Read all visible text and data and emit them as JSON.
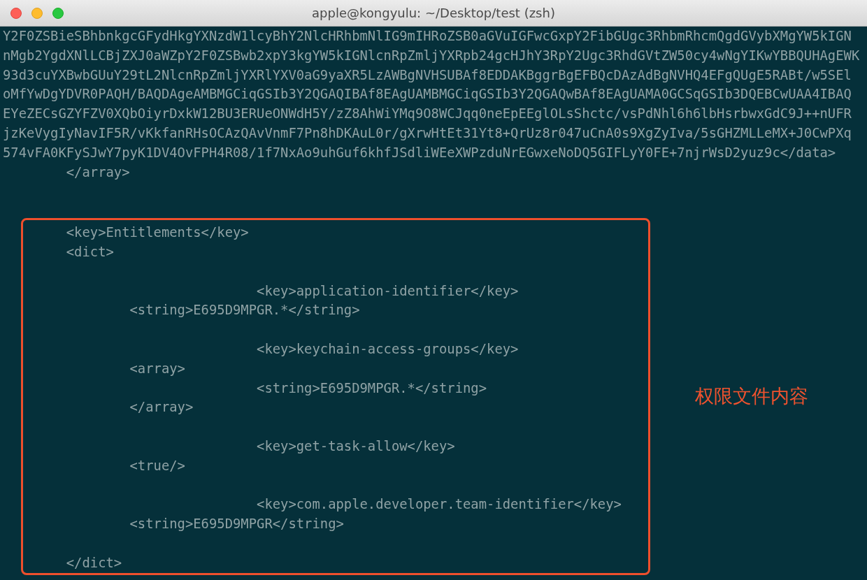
{
  "window": {
    "title": "apple@kongyulu: ~/Desktop/test (zsh)"
  },
  "lines": [
    {
      "kind": "code",
      "text": "Y2F0ZSBieSBhbnkgcGFydHkgYXNzdW1lcyBhY2NlcHRhbmNlIG9mIHRoZSB0aGVuIGFwcGxpY2FibGUgc3RhbmRhcmQgdGVybXMgYW5kIGN"
    },
    {
      "kind": "code",
      "text": "nMgb2YgdXNlLCBjZXJ0aWZpY2F0ZSBwb2xpY3kgYW5kIGNlcnRpZmljYXRpb24gcHJhY3RpY2Ugc3RhdGVtZW50cy4wNgYIKwYBBQUHAgEWK"
    },
    {
      "kind": "code",
      "text": "93d3cuYXBwbGUuY29tL2NlcnRpZmljYXRlYXV0aG9yaXR5LzAWBgNVHSUBAf8EDDAKBggrBgEFBQcDAzAdBgNVHQ4EFgQUgE5RABt/w5SEl"
    },
    {
      "kind": "code",
      "text": "oMfYwDgYDVR0PAQH/BAQDAgeAMBMGCiqGSIb3Y2QGAQIBAf8EAgUAMBMGCiqGSIb3Y2QGAQwBAf8EAgUAMA0GCSqGSIb3DQEBCwUAA4IBAQ"
    },
    {
      "kind": "code",
      "text": "EYeZECsGZYFZV0XQbOiyrDxkW12BU3ERUeONWdH5Y/zZ8AhWiYMq9O8WCJqq0neEpEEglOLsShctc/vsPdNhl6h6lbHsrbwxGdC9J++nUFR"
    },
    {
      "kind": "code",
      "text": "jzKeVygIyNavIF5R/vKkfanRHsOCAzQAvVnmF7Pn8hDKAuL0r/gXrwHtEt31Yt8+QrUz8r047uCnA0s9XgZyIva/5sGHZMLLeMX+J0CwPXq"
    },
    {
      "kind": "code",
      "text": "574vFA0KFySJwY7pyK1DV4OvFPH4R08/1f7NxAo9uhGuf6khfJSdliWEeXWPzduNrEGwxeNoDQ5GIFLyY0FE+7njrWsD2yuz9c</data>"
    },
    {
      "kind": "code",
      "text": "        </array>"
    },
    {
      "kind": "blank"
    }
  ],
  "highlight": {
    "label": "权限文件内容",
    "lines": [
      {
        "kind": "code",
        "text": "        <key>Entitlements</key>"
      },
      {
        "kind": "code",
        "text": "        <dict>"
      },
      {
        "kind": "blank"
      },
      {
        "kind": "code",
        "text": "                                <key>application-identifier</key>"
      },
      {
        "kind": "code",
        "text": "                <string>E695D9MPGR.*</string>"
      },
      {
        "kind": "blank"
      },
      {
        "kind": "code",
        "text": "                                <key>keychain-access-groups</key>"
      },
      {
        "kind": "code",
        "text": "                <array>"
      },
      {
        "kind": "code",
        "text": "                                <string>E695D9MPGR.*</string>"
      },
      {
        "kind": "code",
        "text": "                </array>"
      },
      {
        "kind": "blank"
      },
      {
        "kind": "code",
        "text": "                                <key>get-task-allow</key>"
      },
      {
        "kind": "code",
        "text": "                <true/>"
      },
      {
        "kind": "blank"
      },
      {
        "kind": "code",
        "text": "                                <key>com.apple.developer.team-identifier</key>"
      },
      {
        "kind": "code",
        "text": "                <string>E695D9MPGR</string>"
      },
      {
        "kind": "blank"
      },
      {
        "kind": "code",
        "text": "        </dict>"
      }
    ]
  }
}
